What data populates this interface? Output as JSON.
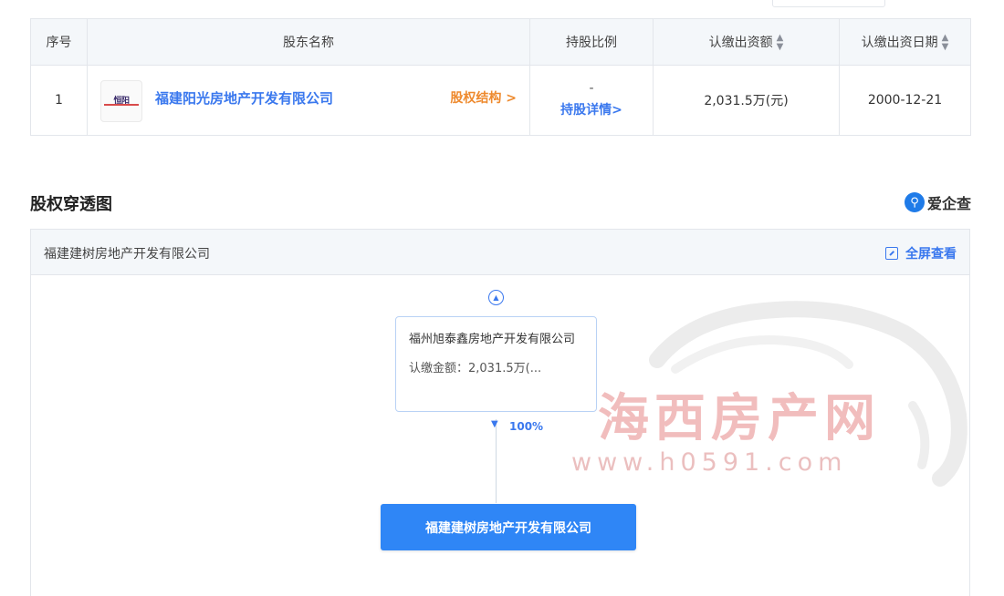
{
  "table": {
    "headers": {
      "index": "序号",
      "shareholder": "股东名称",
      "ratio": "持股比例",
      "subscribed_amount": "认缴出资额",
      "subscribed_date": "认缴出资日期"
    },
    "rows": [
      {
        "index": "1",
        "logo_text": "恒阳",
        "company": "福建阳光房地产开发有限公司",
        "equity_structure": "股权结构 >",
        "ratio": "-",
        "ratio_detail": "持股详情>",
        "amount": "2,031.5万(元)",
        "date": "2000-12-21"
      }
    ]
  },
  "section": {
    "title": "股权穿透图",
    "brand": "爱企查",
    "brand_icon": "magnifier-icon"
  },
  "panel": {
    "title": "福建建树房地产开发有限公司",
    "fullscreen": "全屏查看"
  },
  "chart": {
    "parent_node": {
      "name": "福州旭泰鑫房地产开发有限公司",
      "amount": "认缴金额：2,031.5万(..."
    },
    "edge_percent": "100%",
    "main_node": "福建建树房地产开发有限公司"
  },
  "watermark": {
    "name": "海西房产网",
    "url": "www.h0591.com"
  },
  "colors": {
    "link": "#3a78ee",
    "accent_orange": "#ee8a2e",
    "main_node": "#2f86f6",
    "watermark": "#efb2b2"
  }
}
